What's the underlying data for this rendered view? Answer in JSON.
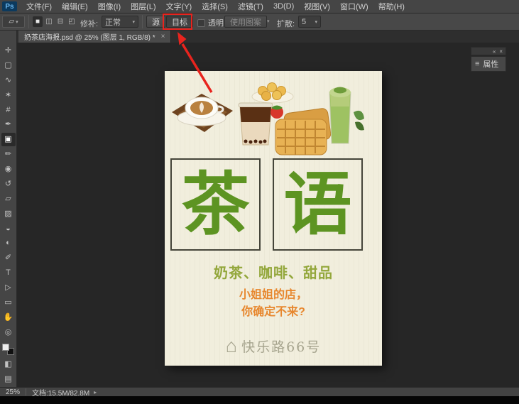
{
  "window": {
    "logo": "Ps"
  },
  "menubar": {
    "items": [
      "文件(F)",
      "编辑(E)",
      "图像(I)",
      "图层(L)",
      "文字(Y)",
      "选择(S)",
      "滤镜(T)",
      "3D(D)",
      "视图(V)",
      "窗口(W)",
      "帮助(H)"
    ]
  },
  "options": {
    "tool_preset_glyph": "▱",
    "select_modes": [
      {
        "name": "new-selection",
        "glyph": "■"
      },
      {
        "name": "add-to-selection",
        "glyph": "◫"
      },
      {
        "name": "subtract-from-selection",
        "glyph": "⊟"
      },
      {
        "name": "intersect-selection",
        "glyph": "◰"
      }
    ],
    "patch_label": "修补:",
    "patch_mode": "正常",
    "source_button": "源",
    "target_button": "目标",
    "transparent_label": "透明",
    "use_pattern_button": "使用图案",
    "diffusion_label": "扩散:",
    "diffusion_value": "5"
  },
  "glyphs": {
    "dropdown_arrow": "▾",
    "collapse_arrows": "«",
    "close": "×",
    "status_menu_arrow": "▸",
    "properties_icon": "≡",
    "house_icon": "⌂"
  },
  "tab": {
    "title": "奶茶店海报.psd @ 25% (图层 1, RGB/8) *",
    "close": "×"
  },
  "toolbar": {
    "tools": [
      {
        "name": "move-tool",
        "glyph": "✛"
      },
      {
        "name": "rectangular-marquee-tool",
        "glyph": "▢"
      },
      {
        "name": "lasso-tool",
        "glyph": "∿"
      },
      {
        "name": "quick-selection-tool",
        "glyph": "✶"
      },
      {
        "name": "crop-tool",
        "glyph": "#"
      },
      {
        "name": "eyedropper-tool",
        "glyph": "✒"
      },
      {
        "name": "patch-tool",
        "glyph": "▣"
      },
      {
        "name": "brush-tool",
        "glyph": "✏"
      },
      {
        "name": "clone-stamp-tool",
        "glyph": "◉"
      },
      {
        "name": "history-brush-tool",
        "glyph": "↺"
      },
      {
        "name": "eraser-tool",
        "glyph": "▱"
      },
      {
        "name": "gradient-tool",
        "glyph": "▨"
      },
      {
        "name": "blur-tool",
        "glyph": "◒"
      },
      {
        "name": "dodge-tool",
        "glyph": "◐"
      },
      {
        "name": "pen-tool",
        "glyph": "✐"
      },
      {
        "name": "type-tool",
        "glyph": "T"
      },
      {
        "name": "path-selection-tool",
        "glyph": "▷"
      },
      {
        "name": "rectangle-tool",
        "glyph": "▭"
      },
      {
        "name": "hand-tool",
        "glyph": "✋"
      },
      {
        "name": "zoom-tool",
        "glyph": "◎"
      }
    ],
    "quick_mask_glyph": "◧",
    "screen_mode_glyph": "▤"
  },
  "panel": {
    "properties_label": "属性"
  },
  "poster": {
    "title_left": "茶",
    "title_right": "语",
    "subtitle": "奶茶、咖啡、甜品",
    "tagline1": "小姐姐的店，",
    "tagline2": "你确定不来?",
    "address": "快乐路66号"
  },
  "statusbar": {
    "zoom": "25%",
    "doc_info": "文档:15.5M/82.8M"
  },
  "colors": {
    "annotation_red": "#e8241e",
    "poster_bg": "#f1eedd",
    "poster_green": "#5d9422",
    "poster_olive": "#93a73b",
    "poster_orange": "#e7872e",
    "ui_dark": "#454545"
  }
}
